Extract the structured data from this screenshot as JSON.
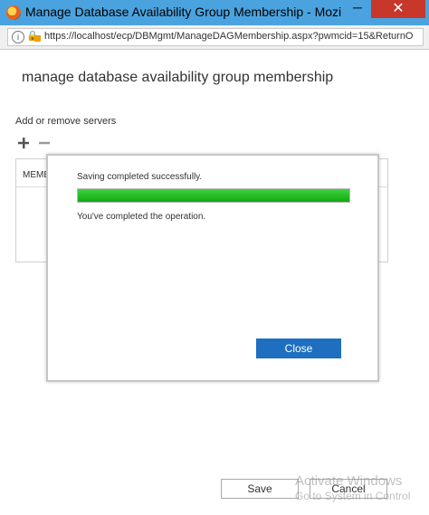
{
  "window": {
    "title": "Manage Database Availability Group Membership - Mozi...",
    "minimize_glyph": "─",
    "close_glyph": "✕"
  },
  "address_bar": {
    "url": "https://localhost/ecp/DBMgmt/ManageDAGMembership.aspx?pwmcid=15&ReturnO"
  },
  "page": {
    "title": "manage database availability group membership",
    "section_label": "Add or remove servers",
    "members_header": "MEMB"
  },
  "dialog": {
    "status_text": "Saving completed successfully.",
    "progress_percent": 100,
    "completed_text": "You've completed the operation.",
    "close_label": "Close"
  },
  "footer": {
    "save_label": "Save",
    "cancel_label": "Cancel"
  },
  "watermark": {
    "line1": "Activate Windows",
    "line2": "Go to System in Control"
  },
  "colors": {
    "titlebar": "#4aa3df",
    "close_window": "#c7382b",
    "progress_fill": "#22b522",
    "primary_button": "#1e6fc0"
  }
}
